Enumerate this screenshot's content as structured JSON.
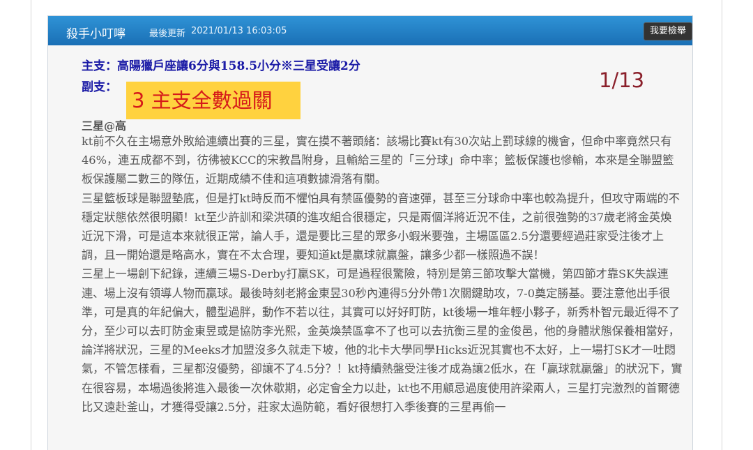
{
  "post": {
    "author": "殺手小叮嚀",
    "updated_label": "最後更新",
    "updated_time": "2021/01/13 16:03:05",
    "report_label": "我要檢舉",
    "pick_main": "主支：高陽獵戶座讓6分與158.5小分※三星受讓2分",
    "pick_sub": "副支：",
    "overlay_result": "3 主支全數過關",
    "overlay_date": "1/13",
    "matchup": "三星@高",
    "paragraphs": [
      "kt前不久在主場意外敗給連續出賽的三星，實在摸不著頭緒：該場比賽kt有30次站上罰球線的機會，但命中率竟然只有46%，連五成都不到，彷彿被KCC的宋教昌附身，且輸給三星的「三分球」命中率；籃板保護也慘輸，本來是全聯盟籃板保護屬二數三的隊伍，近期成績不佳和這項數據滑落有關。",
      "三星籃板球是聯盟墊底，但是打kt時反而不懼怕具有禁區優勢的音速彈，甚至三分球命中率也較為提升，但攻守兩端的不穩定狀態依然很明顯！kt至少許訓和梁洪碩的進攻組合很穩定，只是兩個洋將近況不佳，之前很強勢的37歲老將金英煥近況下滑，可是這本來就很正常，論人手，還是要比三星的眾多小蝦米要強，主場區區2.5分還要經過莊家受注後才上調，且一開始還是略高水，實在不太合理，要知道kt是贏球就贏盤，讓多少都一樣照過不誤！",
      "三星上一場創下紀錄，連續三場S-Derby打贏SK，可是過程很驚險，特別是第三節攻擊大當機，第四節才靠SK失誤連連、場上沒有領導人物而贏球。最後時刻老將金東昱30秒內連得5分外帶1次關鍵助攻，7-0奠定勝基。要注意他出手很準，可是真的年紀偏大，體型過胖，動作不若以往，其實可以好好盯防，kt後場一堆年輕小夥子，新秀朴智元最近得不了分，至少可以去盯防金東昱或是協防李光熙，金英煥禁區拿不了也可以去抗衡三星的金俊邑，他的身體狀態保養相當好，論洋將狀況，三星的Meeks才加盟沒多久就走下坡，他的北卡大學同學Hicks近況其實也不太好，上一場打SK才一吐悶氣，不管怎樣看，三星都沒優勢，卻讓不了4.5分？！kt持續熱盤受注後才成為讓2低水，在「贏球就贏盤」的狀況下，實在很容易，本場過後將進入最後一次休歇期，必定會全力以赴，kt也不用顧忌過度使用許梁兩人，三星打完激烈的首爾德比又遠赴釜山，才獲得受讓2.5分，莊家太過防範，看好很想打入季後賽的三星再偷一"
    ],
    "colors": {
      "header": "#1f7cc2",
      "pick_text": "#1a1aa6",
      "overlay_bg": "#ffd23f",
      "overlay_text": "#d61a1a",
      "date_text": "#8a1f2a"
    }
  }
}
